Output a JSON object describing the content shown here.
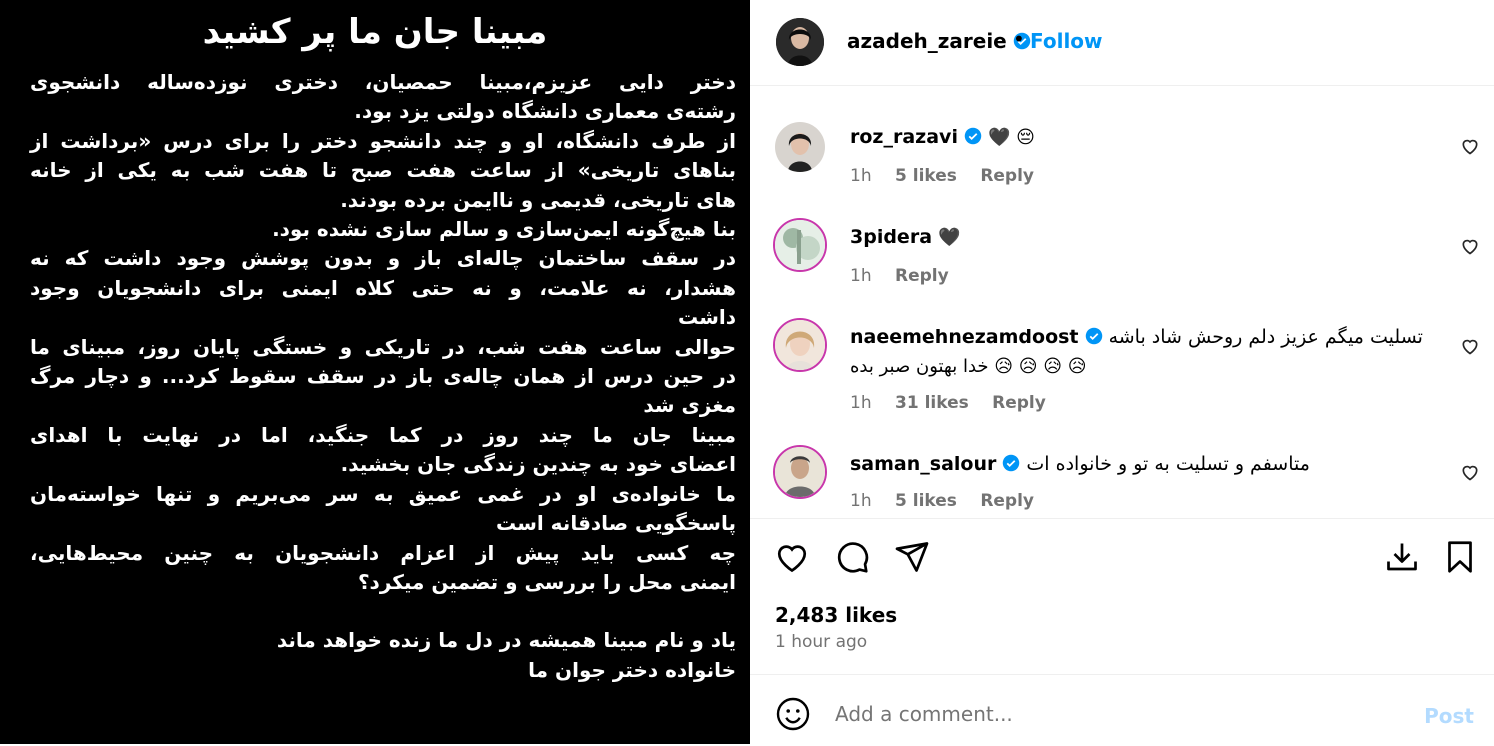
{
  "post": {
    "title": "مبینا جان ما پر کشید",
    "lines": [
      "دختر دایی عزیزم،مبینا حمصیان، دختری نوزده‌ساله دانشجوی",
      "رشته‌ی معماری دانشگاه دولتی یزد بود.",
      "از طرف دانشگاه، او و چند دانشجو دختر را برای درس «برداشت از",
      "بناهای تاریخی» از ساعت هفت صبح تا هفت شب به یکی از خانه",
      "های تاریخی، قدیمی و ناایمن برده بودند.",
      "بنا هیچ‌گونه ایمن‌سازی و سالم سازی نشده بود.",
      "در سقف ساختمان چاله‌ای باز و بدون پوشش وجود داشت که نه",
      "هشدار، نه علامت، و نه حتی کلاه ایمنی برای دانشجویان وجود",
      "داشت",
      "حوالی ساعت هفت شب، در تاریکی و خستگی پایان روز، مبینای ما",
      "در حین درس از همان چاله‌ی باز در سقف سقوط کرد... و دچار مرگ",
      "مغزی شد",
      "مبینا جان ما چند روز در کما جنگید، اما در نهایت با اهدای",
      "اعضای خود به چندین زندگی جان بخشید.",
      "ما خانواده‌ی او در غمی عمیق به سر می‌بریم و تنها خواسته‌مان",
      "پاسخگویی صادقانه است",
      "چه کسی باید پیش از اعزام دانشجویان به چنین محیط‌هایی،",
      "ایمنی محل را بررسی و تضمین میکرد؟",
      "",
      "یاد و نام مبینا همیشه در دل ما زنده خواهد ماند",
      "خانواده دختر جوان ما"
    ]
  },
  "header": {
    "username": "azadeh_zareie",
    "dot": "•",
    "follow_label": "Follow"
  },
  "comments": [
    {
      "username": "roz_razavi",
      "text": "🖤 😔",
      "time": "1h",
      "likes": "5 likes",
      "reply": "Reply",
      "verified": true
    },
    {
      "username": "3pidera",
      "text": "🖤",
      "time": "1h",
      "likes": "",
      "reply": "Reply",
      "verified": false
    },
    {
      "username": "naeemehnezamdoost",
      "text": "تسلیت میگم عزیز دلم روحش شاد باشه",
      "text2": "خدا بهتون صبر بده 😥 😥 😥 😥",
      "time": "1h",
      "likes": "31 likes",
      "reply": "Reply",
      "verified": true
    },
    {
      "username": "saman_salour",
      "text": "متاسفم و تسلیت به تو و خانواده ات",
      "time": "1h",
      "likes": "5 likes",
      "reply": "Reply",
      "verified": true
    }
  ],
  "likes_count": "2,483 likes",
  "time_ago": "1 hour ago",
  "add_comment": {
    "placeholder": "Add a comment...",
    "post_label": "Post"
  },
  "colors": {
    "accent": "#0095f6",
    "verified": "#0095f6",
    "meta": "#737373"
  }
}
